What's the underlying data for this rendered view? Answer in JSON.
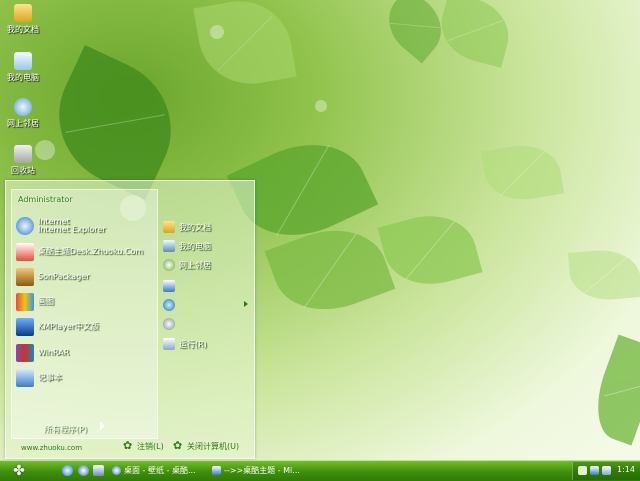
{
  "desktop": {
    "icons": [
      {
        "label": "我的文档",
        "icon": "my-documents-icon"
      },
      {
        "label": "我的电脑",
        "icon": "my-computer-icon"
      },
      {
        "label": "网上邻居",
        "icon": "network-icon"
      },
      {
        "label": "回收站",
        "icon": "recycle-bin-icon"
      }
    ]
  },
  "start_menu": {
    "user": "Administrator",
    "programs": [
      {
        "line1": "Internet",
        "line2": "Internet Explorer",
        "icon": "internet-explorer-icon"
      },
      {
        "line1": "桌酷主题Desk.Zhuoku.Com",
        "line2": "",
        "icon": "theme-icon"
      },
      {
        "line1": "SonPackager",
        "line2": "",
        "icon": "packager-icon"
      },
      {
        "line1": "画图",
        "line2": "",
        "icon": "paint-icon"
      },
      {
        "line1": "KMPlayer中文版",
        "line2": "",
        "icon": "kmplayer-icon"
      },
      {
        "line1": "WinRAR",
        "line2": "",
        "icon": "winrar-icon"
      },
      {
        "line1": "记事本",
        "line2": "",
        "icon": "notepad-icon"
      }
    ],
    "all_programs": "所有程序(P)",
    "places": [
      {
        "label": "我的文档",
        "icon": "documents-icon"
      },
      {
        "label": "我的电脑",
        "icon": "computer-icon"
      },
      {
        "label": "网上邻居",
        "icon": "network-places-icon"
      },
      {
        "label": "",
        "icon": "control-panel-icon"
      },
      {
        "label": "",
        "icon": "connect-icon"
      },
      {
        "label": "",
        "icon": "search-icon"
      },
      {
        "label": "运行(R)",
        "icon": "run-icon"
      }
    ],
    "website": "www.zhuoku.com",
    "logoff": "注销(L)",
    "shutdown": "关闭计算机(U)"
  },
  "taskbar": {
    "tasks": [
      {
        "label": "桌面 - 壁纸 - 桌酷...",
        "icon": "browser-window-icon"
      },
      {
        "label": "-->>桌酷主题 - Mi...",
        "icon": "document-window-icon"
      }
    ],
    "clock": "1:14"
  },
  "colors": {
    "taskbar": "#3f8f0b",
    "accent_text": "#2d7b12"
  }
}
